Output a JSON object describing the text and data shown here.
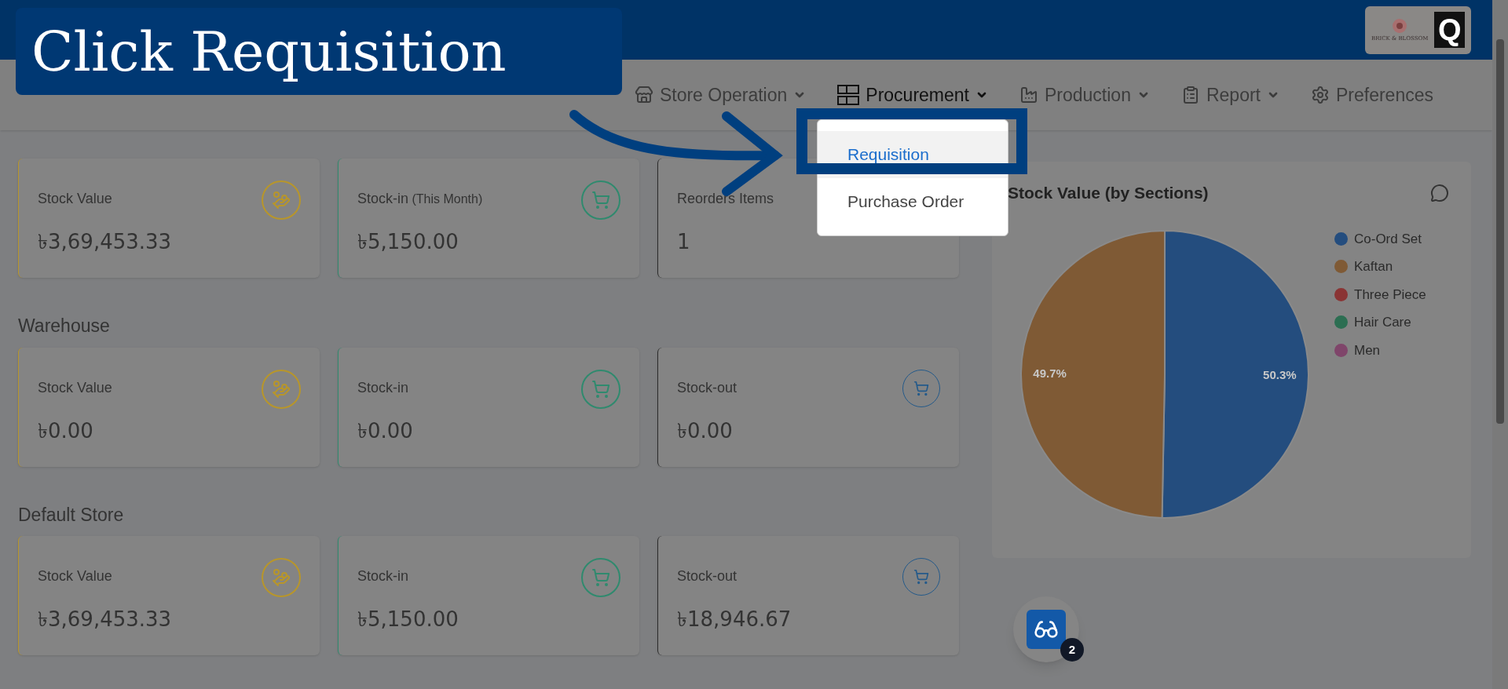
{
  "tutorial": {
    "callout": "Click Requisition"
  },
  "header": {
    "logo_text": "BRICK & BLOSSOM",
    "logo_letter": "Q"
  },
  "nav": [
    {
      "label": "Store Operation",
      "has_menu": true,
      "expanded": false
    },
    {
      "label": "Procurement",
      "has_menu": true,
      "expanded": true
    },
    {
      "label": "Production",
      "has_menu": true,
      "expanded": false
    },
    {
      "label": "Report",
      "has_menu": true,
      "expanded": false
    },
    {
      "label": "Preferences",
      "has_menu": false,
      "expanded": false
    }
  ],
  "dropdown": {
    "items": [
      {
        "label": "Requisition",
        "highlighted": true
      },
      {
        "label": "Purchase Order",
        "highlighted": false
      }
    ]
  },
  "summary": {
    "cards": [
      {
        "kind": "value",
        "label": "Stock Value",
        "value": "৳3,69,453.33"
      },
      {
        "kind": "stockin",
        "label": "Stock-in",
        "note": "(This Month)",
        "value": "৳5,150.00"
      },
      {
        "kind": "reorder",
        "label": "Reorders Items",
        "value": "1"
      }
    ]
  },
  "sections": [
    {
      "title": "Warehouse",
      "cards": [
        {
          "kind": "value",
          "label": "Stock Value",
          "value": "৳0.00"
        },
        {
          "kind": "stockin",
          "label": "Stock-in",
          "value": "৳0.00"
        },
        {
          "kind": "stockout",
          "label": "Stock-out",
          "value": "৳0.00"
        }
      ]
    },
    {
      "title": "Default Store",
      "cards": [
        {
          "kind": "value",
          "label": "Stock Value",
          "value": "৳3,69,453.33"
        },
        {
          "kind": "stockin",
          "label": "Stock-in",
          "value": "৳5,150.00"
        },
        {
          "kind": "stockout",
          "label": "Stock-out",
          "value": "৳18,946.67"
        }
      ]
    }
  ],
  "chart_panel": {
    "title": "Stock Value (by Sections)",
    "chart_data": {
      "type": "pie",
      "categories": [
        "Co-Ord Set",
        "Kaftan",
        "Three Piece",
        "Hair Care",
        "Men"
      ],
      "values": [
        50.3,
        49.7,
        0,
        0,
        0
      ],
      "colors": [
        "#244d7e",
        "#7f5a35",
        "#8a3434",
        "#2c6e52",
        "#7f456a"
      ],
      "value_labels": [
        "50.3%",
        "49.7%",
        null,
        null,
        null
      ],
      "legend": "right"
    }
  },
  "widget": {
    "badge": "2"
  }
}
